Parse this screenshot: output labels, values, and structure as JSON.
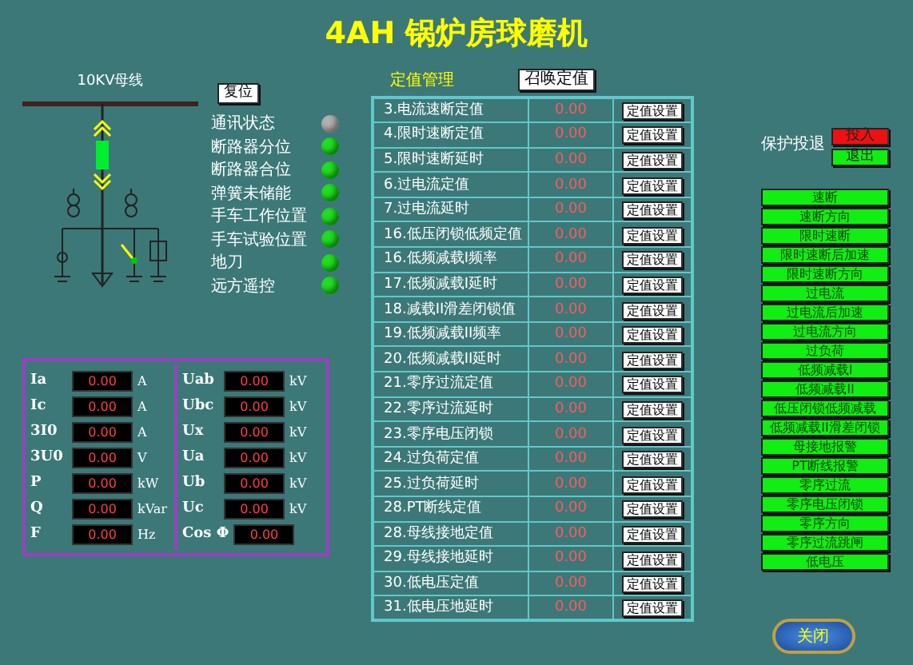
{
  "title": "4AH 锅炉房球磨机",
  "diagram": {
    "bus_label": "10KV母线"
  },
  "reset_button": "复位",
  "status": [
    {
      "label": "通讯状态",
      "on": false
    },
    {
      "label": "断路器分位",
      "on": true
    },
    {
      "label": "断路器合位",
      "on": true
    },
    {
      "label": "弹簧未储能",
      "on": true
    },
    {
      "label": "手车工作位置",
      "on": true
    },
    {
      "label": "手车试验位置",
      "on": true
    },
    {
      "label": "地刀",
      "on": true
    },
    {
      "label": "远方遥控",
      "on": true
    }
  ],
  "meters": [
    [
      {
        "name": "Ia",
        "value": "0.00",
        "unit": "A"
      },
      {
        "name": "Ic",
        "value": "0.00",
        "unit": "A"
      },
      {
        "name": "3I0",
        "value": "0.00",
        "unit": "A"
      },
      {
        "name": "3U0",
        "value": "0.00",
        "unit": "V"
      },
      {
        "name": "P",
        "value": "0.00",
        "unit": "kW"
      },
      {
        "name": "Q",
        "value": "0.00",
        "unit": "kVar"
      },
      {
        "name": "F",
        "value": "0.00",
        "unit": "Hz"
      }
    ],
    [
      {
        "name": "Uab",
        "value": "0.00",
        "unit": "kV"
      },
      {
        "name": "Ubc",
        "value": "0.00",
        "unit": "kV"
      },
      {
        "name": "Ux",
        "value": "0.00",
        "unit": "kV"
      },
      {
        "name": "Ua",
        "value": "0.00",
        "unit": "kV"
      },
      {
        "name": "Ub",
        "value": "0.00",
        "unit": "kV"
      },
      {
        "name": "Uc",
        "value": "0.00",
        "unit": "kV"
      },
      {
        "name": "Cos Φ",
        "value": "0.00"
      }
    ]
  ],
  "settings": {
    "heading": "定值管理",
    "recall_button": "召唤定值",
    "rows": [
      {
        "name": "3.电流速断定值",
        "value": "0.00",
        "button": "定值设置"
      },
      {
        "name": "4.限时速断定值",
        "value": "0.00",
        "button": "定值设置"
      },
      {
        "name": "5.限时速断延时",
        "value": "0.00",
        "button": "定值设置"
      },
      {
        "name": "6.过电流定值",
        "value": "0.00",
        "button": "定值设置"
      },
      {
        "name": "7.过电流延时",
        "value": "0.00",
        "button": "定值设置"
      },
      {
        "name": "16.低压闭锁低频定值",
        "value": "0.00",
        "button": "定值设置"
      },
      {
        "name": "16.低频减载I频率",
        "value": "0.00",
        "button": "定值设置"
      },
      {
        "name": "17.低频减载I延时",
        "value": "0.00",
        "button": "定值设置"
      },
      {
        "name": "18.减载II滑差闭锁值",
        "value": "0.00",
        "button": "定值设置"
      },
      {
        "name": "19.低频减载II频率",
        "value": "0.00",
        "button": "定值设置"
      },
      {
        "name": "20.低频减载II延时",
        "value": "0.00",
        "button": "定值设置"
      },
      {
        "name": "21.零序过流定值",
        "value": "0.00",
        "button": "定值设置"
      },
      {
        "name": "22.零序过流延时",
        "value": "0.00",
        "button": "定值设置"
      },
      {
        "name": "23.零序电压闭锁",
        "value": "0.00",
        "button": "定值设置"
      },
      {
        "name": "24.过负荷定值",
        "value": "0.00",
        "button": "定值设置"
      },
      {
        "name": "25.过负荷延时",
        "value": "0.00",
        "button": "定值设置"
      },
      {
        "name": "28.PT断线定值",
        "value": "0.00",
        "button": "定值设置"
      },
      {
        "name": "28.母线接地定值",
        "value": "0.00",
        "button": "定值设置"
      },
      {
        "name": "29.母线接地延时",
        "value": "0.00",
        "button": "定值设置"
      },
      {
        "name": "30.低电压定值",
        "value": "0.00",
        "button": "定值设置"
      },
      {
        "name": "31.低电压地延时",
        "value": "0.00",
        "button": "定值设置"
      }
    ]
  },
  "protection": {
    "label": "保护投退",
    "toggles": [
      {
        "label": "投入",
        "selected": true
      },
      {
        "label": "退出",
        "selected": false
      }
    ],
    "functions": [
      "速断",
      "速断方向",
      "限时速断",
      "限时速断后加速",
      "限时速断方向",
      "过电流",
      "过电流后加速",
      "过电流方向",
      "过负荷",
      "低频减载I",
      "低频减载II",
      "低压闭锁低频减载",
      "低频减载II滑差闭锁",
      "母接地报警",
      "PT断线报警",
      "零序过流",
      "零序电压闭锁",
      "零序方向",
      "零序过流跳闸",
      "低电压"
    ]
  },
  "close_button": "关闭"
}
